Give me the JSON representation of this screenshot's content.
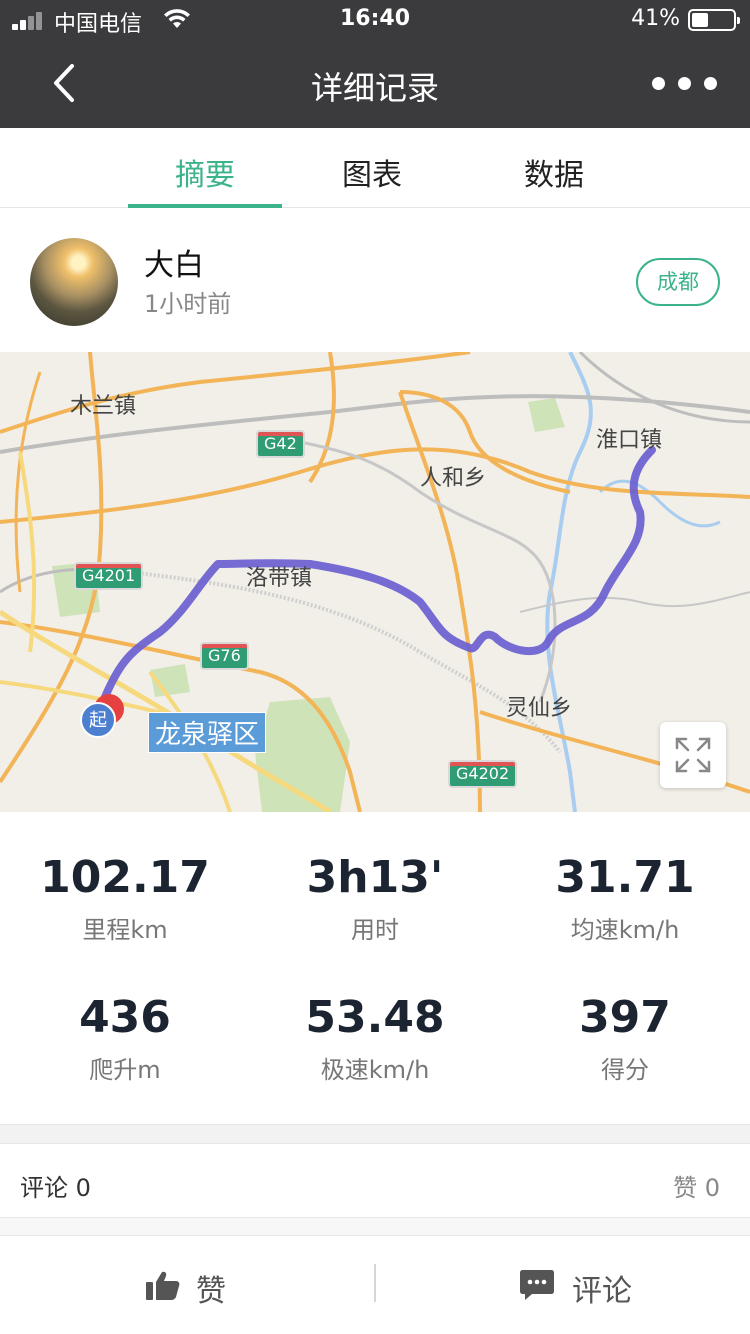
{
  "status_bar": {
    "carrier": "中国电信",
    "time": "16:40",
    "battery_percent": "41%",
    "battery_level": 0.41,
    "icons": [
      "signal-icon",
      "wifi-icon",
      "battery-icon"
    ]
  },
  "nav": {
    "title": "详细记录",
    "back_icon": "chevron-left-icon",
    "more_icon": "more-dots-icon"
  },
  "tabs": [
    {
      "label": "摘要",
      "active": true
    },
    {
      "label": "图表",
      "active": false
    },
    {
      "label": "数据",
      "active": false
    }
  ],
  "user": {
    "name": "大白",
    "time_ago": "1小时前",
    "city": "成都"
  },
  "map": {
    "places": [
      "木兰镇",
      "人和乡",
      "淮口镇",
      "洛带镇",
      "灵仙乡"
    ],
    "highways": [
      "G42",
      "G4201",
      "G76",
      "G4202"
    ],
    "district": "龙泉驿区",
    "start_marker": "起",
    "route_color": "#6a5fd0",
    "expand_icon": "expand-icon"
  },
  "stats": [
    {
      "value": "102.17",
      "label": "里程km"
    },
    {
      "value": "3h13'",
      "label": "用时"
    },
    {
      "value": "31.71",
      "label": "均速km/h"
    },
    {
      "value": "436",
      "label": "爬升m"
    },
    {
      "value": "53.48",
      "label": "极速km/h"
    },
    {
      "value": "397",
      "label": "得分"
    }
  ],
  "social": {
    "comments": "评论 0",
    "likes": "赞 0"
  },
  "actions": {
    "like": "赞",
    "comment": "评论"
  },
  "colors": {
    "accent": "#3db38a",
    "nav_bg": "#3b3b3e"
  }
}
